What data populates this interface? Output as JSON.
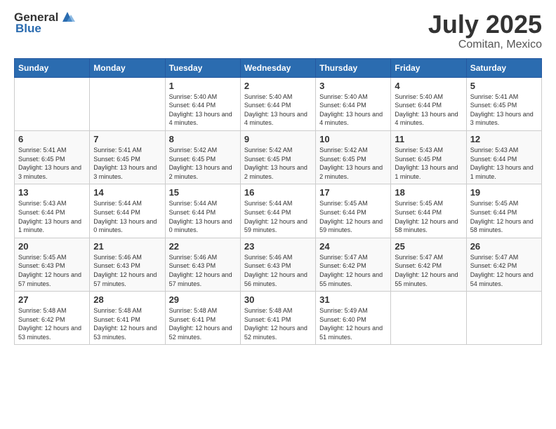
{
  "header": {
    "logo_general": "General",
    "logo_blue": "Blue",
    "title": "July 2025",
    "location": "Comitan, Mexico"
  },
  "weekdays": [
    "Sunday",
    "Monday",
    "Tuesday",
    "Wednesday",
    "Thursday",
    "Friday",
    "Saturday"
  ],
  "weeks": [
    [
      {
        "day": "",
        "sunrise": "",
        "sunset": "",
        "daylight": ""
      },
      {
        "day": "",
        "sunrise": "",
        "sunset": "",
        "daylight": ""
      },
      {
        "day": "1",
        "sunrise": "Sunrise: 5:40 AM",
        "sunset": "Sunset: 6:44 PM",
        "daylight": "Daylight: 13 hours and 4 minutes."
      },
      {
        "day": "2",
        "sunrise": "Sunrise: 5:40 AM",
        "sunset": "Sunset: 6:44 PM",
        "daylight": "Daylight: 13 hours and 4 minutes."
      },
      {
        "day": "3",
        "sunrise": "Sunrise: 5:40 AM",
        "sunset": "Sunset: 6:44 PM",
        "daylight": "Daylight: 13 hours and 4 minutes."
      },
      {
        "day": "4",
        "sunrise": "Sunrise: 5:40 AM",
        "sunset": "Sunset: 6:44 PM",
        "daylight": "Daylight: 13 hours and 4 minutes."
      },
      {
        "day": "5",
        "sunrise": "Sunrise: 5:41 AM",
        "sunset": "Sunset: 6:45 PM",
        "daylight": "Daylight: 13 hours and 3 minutes."
      }
    ],
    [
      {
        "day": "6",
        "sunrise": "Sunrise: 5:41 AM",
        "sunset": "Sunset: 6:45 PM",
        "daylight": "Daylight: 13 hours and 3 minutes."
      },
      {
        "day": "7",
        "sunrise": "Sunrise: 5:41 AM",
        "sunset": "Sunset: 6:45 PM",
        "daylight": "Daylight: 13 hours and 3 minutes."
      },
      {
        "day": "8",
        "sunrise": "Sunrise: 5:42 AM",
        "sunset": "Sunset: 6:45 PM",
        "daylight": "Daylight: 13 hours and 2 minutes."
      },
      {
        "day": "9",
        "sunrise": "Sunrise: 5:42 AM",
        "sunset": "Sunset: 6:45 PM",
        "daylight": "Daylight: 13 hours and 2 minutes."
      },
      {
        "day": "10",
        "sunrise": "Sunrise: 5:42 AM",
        "sunset": "Sunset: 6:45 PM",
        "daylight": "Daylight: 13 hours and 2 minutes."
      },
      {
        "day": "11",
        "sunrise": "Sunrise: 5:43 AM",
        "sunset": "Sunset: 6:45 PM",
        "daylight": "Daylight: 13 hours and 1 minute."
      },
      {
        "day": "12",
        "sunrise": "Sunrise: 5:43 AM",
        "sunset": "Sunset: 6:44 PM",
        "daylight": "Daylight: 13 hours and 1 minute."
      }
    ],
    [
      {
        "day": "13",
        "sunrise": "Sunrise: 5:43 AM",
        "sunset": "Sunset: 6:44 PM",
        "daylight": "Daylight: 13 hours and 1 minute."
      },
      {
        "day": "14",
        "sunrise": "Sunrise: 5:44 AM",
        "sunset": "Sunset: 6:44 PM",
        "daylight": "Daylight: 13 hours and 0 minutes."
      },
      {
        "day": "15",
        "sunrise": "Sunrise: 5:44 AM",
        "sunset": "Sunset: 6:44 PM",
        "daylight": "Daylight: 13 hours and 0 minutes."
      },
      {
        "day": "16",
        "sunrise": "Sunrise: 5:44 AM",
        "sunset": "Sunset: 6:44 PM",
        "daylight": "Daylight: 12 hours and 59 minutes."
      },
      {
        "day": "17",
        "sunrise": "Sunrise: 5:45 AM",
        "sunset": "Sunset: 6:44 PM",
        "daylight": "Daylight: 12 hours and 59 minutes."
      },
      {
        "day": "18",
        "sunrise": "Sunrise: 5:45 AM",
        "sunset": "Sunset: 6:44 PM",
        "daylight": "Daylight: 12 hours and 58 minutes."
      },
      {
        "day": "19",
        "sunrise": "Sunrise: 5:45 AM",
        "sunset": "Sunset: 6:44 PM",
        "daylight": "Daylight: 12 hours and 58 minutes."
      }
    ],
    [
      {
        "day": "20",
        "sunrise": "Sunrise: 5:45 AM",
        "sunset": "Sunset: 6:43 PM",
        "daylight": "Daylight: 12 hours and 57 minutes."
      },
      {
        "day": "21",
        "sunrise": "Sunrise: 5:46 AM",
        "sunset": "Sunset: 6:43 PM",
        "daylight": "Daylight: 12 hours and 57 minutes."
      },
      {
        "day": "22",
        "sunrise": "Sunrise: 5:46 AM",
        "sunset": "Sunset: 6:43 PM",
        "daylight": "Daylight: 12 hours and 57 minutes."
      },
      {
        "day": "23",
        "sunrise": "Sunrise: 5:46 AM",
        "sunset": "Sunset: 6:43 PM",
        "daylight": "Daylight: 12 hours and 56 minutes."
      },
      {
        "day": "24",
        "sunrise": "Sunrise: 5:47 AM",
        "sunset": "Sunset: 6:42 PM",
        "daylight": "Daylight: 12 hours and 55 minutes."
      },
      {
        "day": "25",
        "sunrise": "Sunrise: 5:47 AM",
        "sunset": "Sunset: 6:42 PM",
        "daylight": "Daylight: 12 hours and 55 minutes."
      },
      {
        "day": "26",
        "sunrise": "Sunrise: 5:47 AM",
        "sunset": "Sunset: 6:42 PM",
        "daylight": "Daylight: 12 hours and 54 minutes."
      }
    ],
    [
      {
        "day": "27",
        "sunrise": "Sunrise: 5:48 AM",
        "sunset": "Sunset: 6:42 PM",
        "daylight": "Daylight: 12 hours and 53 minutes."
      },
      {
        "day": "28",
        "sunrise": "Sunrise: 5:48 AM",
        "sunset": "Sunset: 6:41 PM",
        "daylight": "Daylight: 12 hours and 53 minutes."
      },
      {
        "day": "29",
        "sunrise": "Sunrise: 5:48 AM",
        "sunset": "Sunset: 6:41 PM",
        "daylight": "Daylight: 12 hours and 52 minutes."
      },
      {
        "day": "30",
        "sunrise": "Sunrise: 5:48 AM",
        "sunset": "Sunset: 6:41 PM",
        "daylight": "Daylight: 12 hours and 52 minutes."
      },
      {
        "day": "31",
        "sunrise": "Sunrise: 5:49 AM",
        "sunset": "Sunset: 6:40 PM",
        "daylight": "Daylight: 12 hours and 51 minutes."
      },
      {
        "day": "",
        "sunrise": "",
        "sunset": "",
        "daylight": ""
      },
      {
        "day": "",
        "sunrise": "",
        "sunset": "",
        "daylight": ""
      }
    ]
  ]
}
